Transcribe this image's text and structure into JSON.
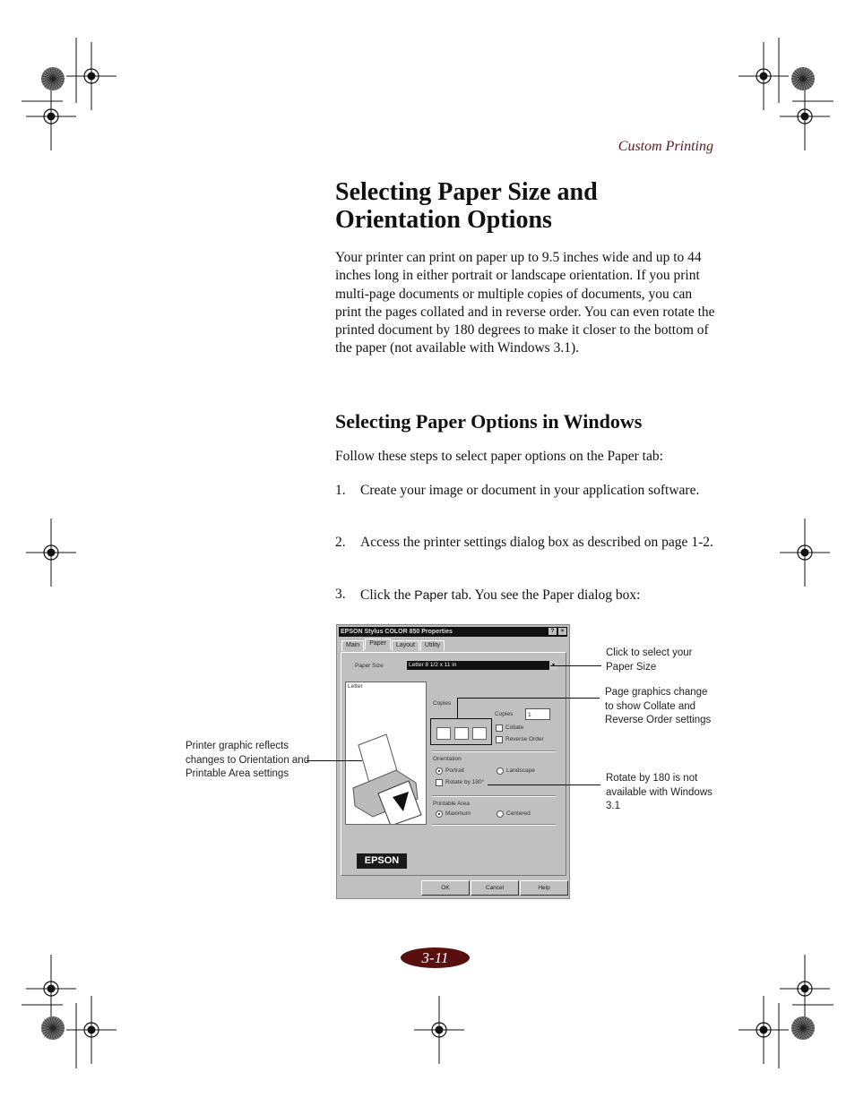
{
  "running_head": "Custom Printing",
  "title": "Selecting Paper Size and Orientation Options",
  "intro": "Your printer can print on paper up to 9.5 inches wide and up to 44 inches long in either portrait or landscape orientation. If you print multi-page documents or multiple copies of documents, you can print the pages collated and in reverse order. You can even rotate the printed document by 180 degrees to make it closer to the bottom of the paper (not available with Windows 3.1).",
  "section_heading": "Selecting Paper Options in Windows",
  "section_intro": "Follow these steps to select paper options on the Paper tab:",
  "steps": [
    {
      "num": "1.",
      "text": "Create your image or document in your application software."
    },
    {
      "num": "2.",
      "text": "Access the printer settings dialog box as described on page 1-2."
    },
    {
      "num": "3.",
      "pre": "Click the ",
      "ui": "Paper",
      "post": " tab. You see the Paper dialog box:"
    }
  ],
  "dialog": {
    "title": "EPSON Stylus COLOR 850 Properties",
    "help_btn": "?",
    "close_btn": "×",
    "tabs": [
      "Main",
      "Paper",
      "Layout",
      "Utility"
    ],
    "paper_size_label": "Paper Size",
    "paper_size_value": "Letter 8 1/2 x 11 in",
    "preview_label": "Letter",
    "copies_group": "Copies",
    "copies_label": "Copies",
    "copies_value": "1",
    "collate": "Collate",
    "reverse_order": "Reverse Order",
    "orientation_group": "Orientation",
    "portrait": "Portrait",
    "landscape": "Landscape",
    "rotate": "Rotate by 180°",
    "printable_area_group": "Printable Area",
    "maximum": "Maximum",
    "centered": "Centered",
    "logo": "EPSON",
    "ok": "OK",
    "cancel": "Cancel",
    "help": "Help"
  },
  "callouts": {
    "paper_size": "Click to select your Paper Size",
    "page_graphics": "Page graphics change to show Collate and Reverse Order settings",
    "rotate": "Rotate by 180  is not available with Windows 3.1",
    "printer_graphic": "Printer graphic reflects changes to Orientation and Printable Area settings"
  },
  "page_number": "3-11"
}
